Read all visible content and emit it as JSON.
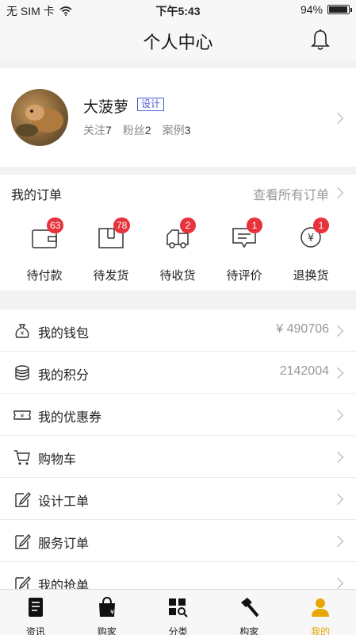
{
  "status": {
    "carrier": "无 SIM 卡",
    "time": "下午5:43",
    "battery": "94%",
    "battery_level": 0.94
  },
  "nav": {
    "title": "个人中心",
    "bell_icon": "bell-icon"
  },
  "profile": {
    "name": "大菠萝",
    "tag": "设计",
    "stats": [
      {
        "label": "关注",
        "value": "7"
      },
      {
        "label": "粉丝",
        "value": "2"
      },
      {
        "label": "案例",
        "value": "3"
      }
    ]
  },
  "orders": {
    "title": "我的订单",
    "view_all": "查看所有订单",
    "items": [
      {
        "label": "待付款",
        "badge": "63",
        "icon": "wallet-icon"
      },
      {
        "label": "待发货",
        "badge": "78",
        "icon": "package-icon"
      },
      {
        "label": "待收货",
        "badge": "2",
        "icon": "truck-icon"
      },
      {
        "label": "待评价",
        "badge": "1",
        "icon": "comment-icon"
      },
      {
        "label": "退换货",
        "badge": "1",
        "icon": "refund-icon"
      }
    ]
  },
  "menu": [
    {
      "label": "我的钱包",
      "value": "¥ 490706",
      "icon": "money-bag-icon"
    },
    {
      "label": "我的积分",
      "value": "2142004",
      "icon": "coins-icon"
    },
    {
      "label": "我的优惠券",
      "value": "",
      "icon": "coupon-icon"
    },
    {
      "label": "购物车",
      "value": "",
      "icon": "cart-icon"
    },
    {
      "label": "设计工单",
      "value": "",
      "icon": "edit-icon"
    },
    {
      "label": "服务订单",
      "value": "",
      "icon": "edit-icon"
    },
    {
      "label": "我的抢单",
      "value": "",
      "icon": "edit-icon"
    }
  ],
  "tabs": [
    {
      "label": "资讯",
      "icon": "news-icon"
    },
    {
      "label": "购家",
      "icon": "shopping-bag-icon"
    },
    {
      "label": "分类",
      "icon": "category-icon"
    },
    {
      "label": "构家",
      "icon": "hammer-icon"
    },
    {
      "label": "我的",
      "icon": "person-icon",
      "active": true
    }
  ],
  "colors": {
    "accent": "#e8a700",
    "badge": "#e8323c",
    "tag": "#4a5bd8"
  }
}
